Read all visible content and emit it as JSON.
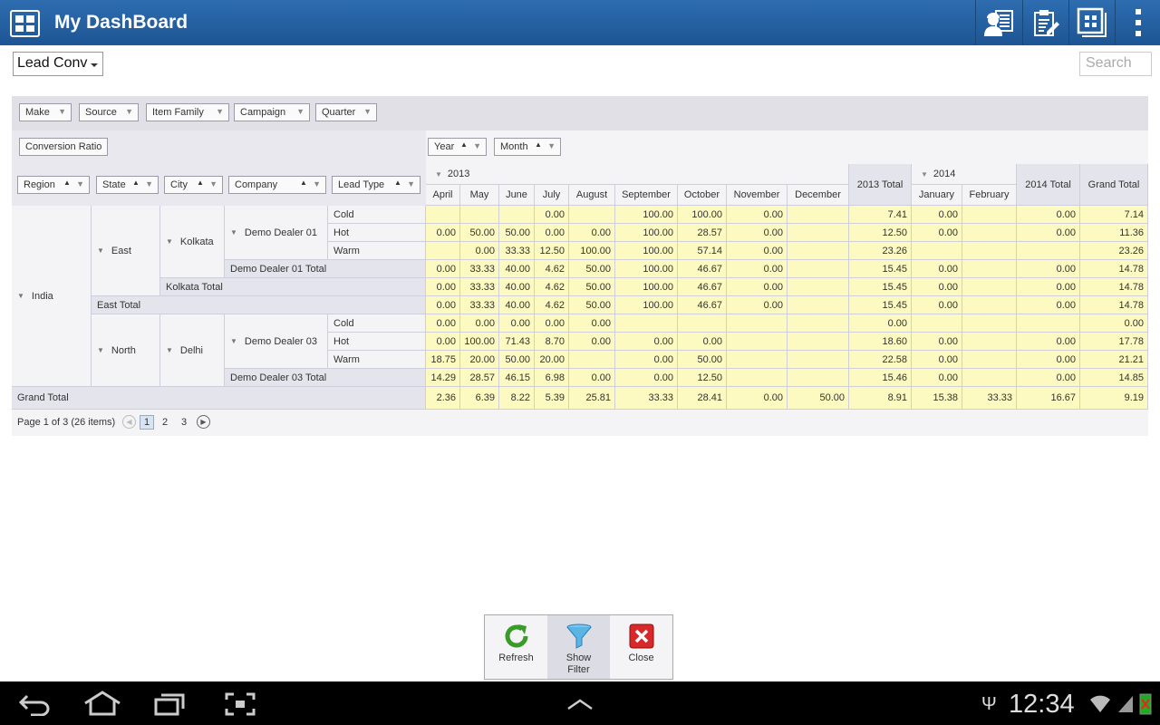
{
  "header": {
    "title": "My DashBoard",
    "icons": [
      "grid-icon",
      "worker-profile-icon",
      "clipboard-edit-icon",
      "dashboard-grid-icon",
      "overflow-menu-icon"
    ]
  },
  "report_select": {
    "value": "Lead Conv"
  },
  "search": {
    "placeholder": "Search"
  },
  "filters": [
    "Make",
    "Source",
    "Item Family",
    "Campaign",
    "Quarter"
  ],
  "data_field": "Conversion Ratio",
  "column_fields": [
    "Year",
    "Month"
  ],
  "row_fields": [
    "Region",
    "State",
    "City",
    "Company",
    "Lead Type"
  ],
  "years": {
    "y2013": "2013",
    "y2014": "2014"
  },
  "columns": [
    "April",
    "May",
    "June",
    "July",
    "August",
    "September",
    "October",
    "November",
    "December",
    "2013 Total",
    "January",
    "February",
    "2014 Total",
    "Grand Total"
  ],
  "row_labels": {
    "india": "India",
    "east": "East",
    "kolkata": "Kolkata",
    "dd01": "Demo Dealer 01",
    "cold": "Cold",
    "hot": "Hot",
    "warm": "Warm",
    "dd01_total": "Demo Dealer 01 Total",
    "kolkata_total": "Kolkata Total",
    "east_total": "East Total",
    "north": "North",
    "delhi": "Delhi",
    "dd03": "Demo Dealer 03",
    "cold2": "Cold",
    "hot2": "Hot",
    "warm2": "Warm",
    "dd03_total": "Demo Dealer 03 Total",
    "grand_total": "Grand Total"
  },
  "rows": [
    [
      "",
      "",
      "",
      "0.00",
      "",
      "100.00",
      "100.00",
      "0.00",
      "",
      "7.41",
      "0.00",
      "",
      "0.00",
      "7.14"
    ],
    [
      "0.00",
      "50.00",
      "50.00",
      "0.00",
      "0.00",
      "100.00",
      "28.57",
      "0.00",
      "",
      "12.50",
      "0.00",
      "",
      "0.00",
      "11.36"
    ],
    [
      "",
      "0.00",
      "33.33",
      "12.50",
      "100.00",
      "100.00",
      "57.14",
      "0.00",
      "",
      "23.26",
      "",
      "",
      "",
      "23.26"
    ],
    [
      "0.00",
      "33.33",
      "40.00",
      "4.62",
      "50.00",
      "100.00",
      "46.67",
      "0.00",
      "",
      "15.45",
      "0.00",
      "",
      "0.00",
      "14.78"
    ],
    [
      "0.00",
      "33.33",
      "40.00",
      "4.62",
      "50.00",
      "100.00",
      "46.67",
      "0.00",
      "",
      "15.45",
      "0.00",
      "",
      "0.00",
      "14.78"
    ],
    [
      "0.00",
      "33.33",
      "40.00",
      "4.62",
      "50.00",
      "100.00",
      "46.67",
      "0.00",
      "",
      "15.45",
      "0.00",
      "",
      "0.00",
      "14.78"
    ],
    [
      "0.00",
      "0.00",
      "0.00",
      "0.00",
      "0.00",
      "",
      "",
      "",
      "",
      "0.00",
      "",
      "",
      "",
      "0.00"
    ],
    [
      "0.00",
      "100.00",
      "71.43",
      "8.70",
      "0.00",
      "0.00",
      "0.00",
      "",
      "",
      "18.60",
      "0.00",
      "",
      "0.00",
      "17.78"
    ],
    [
      "18.75",
      "20.00",
      "50.00",
      "20.00",
      "",
      "0.00",
      "50.00",
      "",
      "",
      "22.58",
      "0.00",
      "",
      "0.00",
      "21.21"
    ],
    [
      "14.29",
      "28.57",
      "46.15",
      "6.98",
      "0.00",
      "0.00",
      "12.50",
      "",
      "",
      "15.46",
      "0.00",
      "",
      "0.00",
      "14.85"
    ],
    [
      "2.36",
      "6.39",
      "8.22",
      "5.39",
      "25.81",
      "33.33",
      "28.41",
      "0.00",
      "50.00",
      "8.91",
      "15.38",
      "33.33",
      "16.67",
      "9.19"
    ]
  ],
  "pager": {
    "info": "Page 1 of 3 (26 items)",
    "pages": [
      "1",
      "2",
      "3"
    ],
    "current": "1"
  },
  "toolbar": {
    "refresh": "Refresh",
    "show_filter": "Show\nFilter",
    "close": "Close"
  },
  "statusbar": {
    "time": "12:34"
  }
}
